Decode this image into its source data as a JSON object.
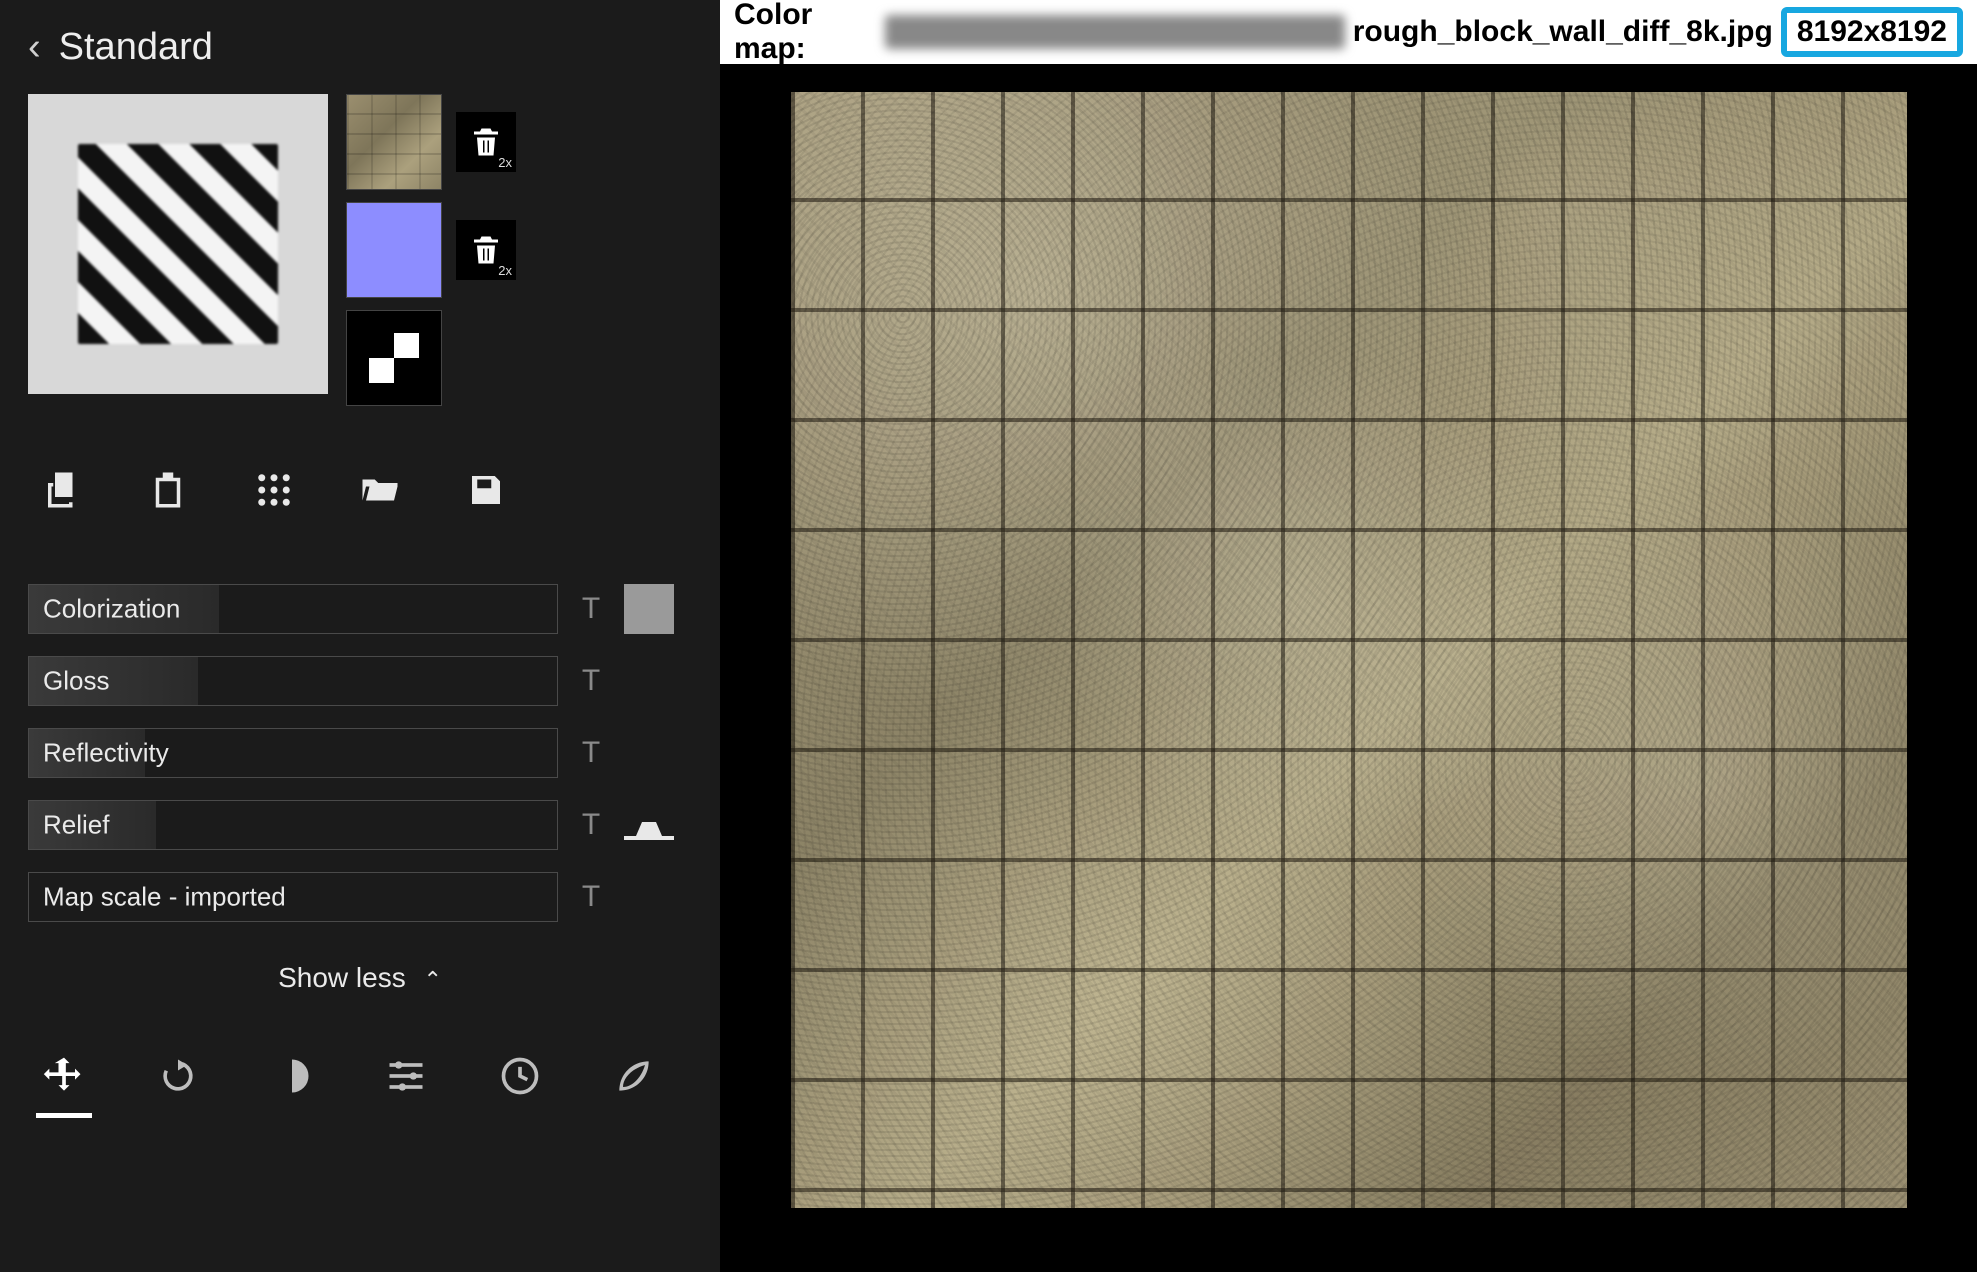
{
  "sidebar": {
    "back_icon": "chevron-left",
    "title": "Standard",
    "slots": [
      {
        "name": "color-map-slot",
        "trash_sub": "2x"
      },
      {
        "name": "normal-map-slot",
        "trash_sub": "2x"
      },
      {
        "name": "alpha-map-slot"
      }
    ],
    "toolbar": [
      {
        "name": "copy-button"
      },
      {
        "name": "paste-button"
      },
      {
        "name": "sample-grid-button"
      },
      {
        "name": "open-folder-button"
      },
      {
        "name": "save-button"
      }
    ],
    "sliders": {
      "colorization": {
        "label": "Colorization",
        "fill_pct": 36,
        "has_t": true,
        "has_swatch": true
      },
      "gloss": {
        "label": "Gloss",
        "fill_pct": 32,
        "has_t": true
      },
      "reflectivity": {
        "label": "Reflectivity",
        "fill_pct": 22,
        "has_t": true
      },
      "relief": {
        "label": "Relief",
        "fill_pct": 24,
        "has_t": true,
        "has_relief_icon": true
      },
      "map_scale": {
        "label": "Map scale - imported",
        "fill_pct": 0,
        "has_t": true
      }
    },
    "show_less": "Show less",
    "bottombar": [
      {
        "name": "move-tool-button",
        "active": true
      },
      {
        "name": "rotate-tool-button"
      },
      {
        "name": "contrast-tool-button"
      },
      {
        "name": "sliders-tool-button"
      },
      {
        "name": "history-button"
      },
      {
        "name": "leaf-button"
      }
    ]
  },
  "main": {
    "pathbar": {
      "label": "Color map:",
      "file": "rough_block_wall_diff_8k.jpg",
      "dimensions": "8192x8192"
    }
  },
  "annotation": {
    "arrow_color": "#17a7e0"
  }
}
